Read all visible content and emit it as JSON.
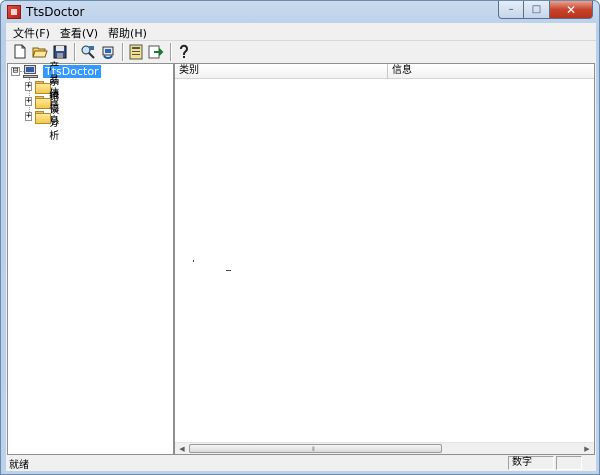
{
  "window": {
    "title": "TtsDoctor"
  },
  "menu": [
    {
      "label": "文件(F)"
    },
    {
      "label": "查看(V)"
    },
    {
      "label": "帮助(H)"
    }
  ],
  "toolbar": {
    "buttons": [
      "new-icon",
      "open-icon",
      "save-icon",
      "scan-icon",
      "refresh-icon",
      "report-icon",
      "export-icon",
      "help-icon"
    ]
  },
  "tree": {
    "root": {
      "label": "TtsDoctor",
      "expander": "⊟"
    },
    "children": [
      {
        "label": "产品信息",
        "expander": "+"
      },
      {
        "label": "系统信息",
        "expander": "+"
      },
      {
        "label": "错误分析",
        "expander": "+"
      }
    ]
  },
  "list": {
    "columns": [
      "类别",
      "信息"
    ],
    "scroll_grip": "⦀"
  },
  "status": {
    "text": "就绪",
    "indicators": [
      "数字",
      ""
    ]
  }
}
